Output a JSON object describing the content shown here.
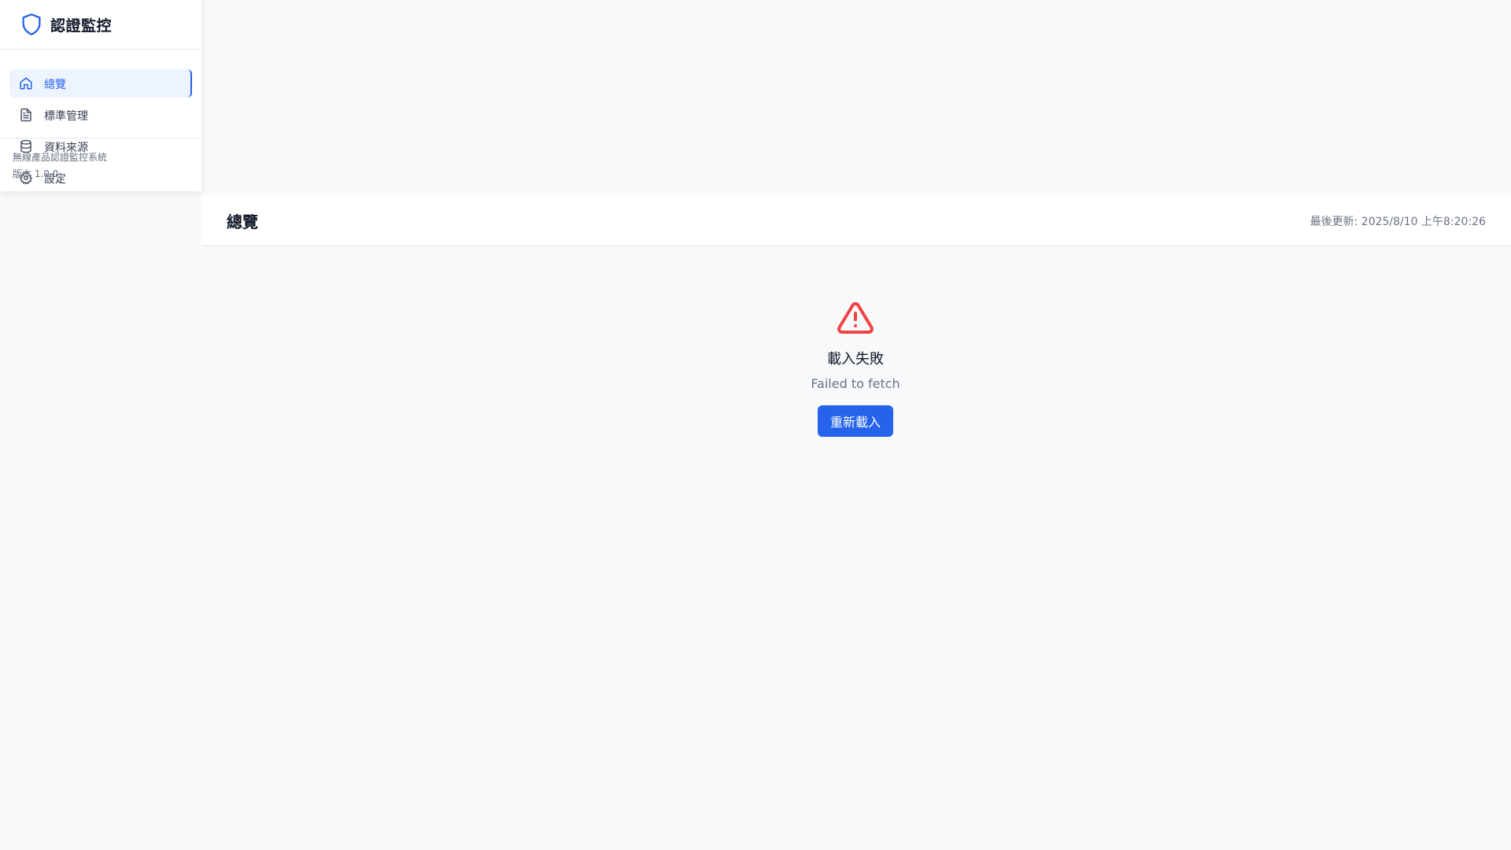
{
  "sidebar": {
    "brand_title": "認證監控",
    "brand_icon": "shield-icon",
    "items": [
      {
        "label": "總覽",
        "icon": "home-icon",
        "active": true
      },
      {
        "label": "標準管理",
        "icon": "document-icon",
        "active": false
      },
      {
        "label": "資料來源",
        "icon": "database-icon",
        "active": false
      },
      {
        "label": "設定",
        "icon": "gear-icon",
        "active": false
      }
    ],
    "footer": {
      "system_name": "無線產品認證監控系統",
      "version": "版本 1.0.0"
    }
  },
  "header": {
    "title": "總覽",
    "last_updated": "最後更新: 2025/8/10 上午8:20:26"
  },
  "error": {
    "icon": "warning-triangle-icon",
    "title": "載入失敗",
    "message": "Failed to fetch",
    "retry_label": "重新載入"
  },
  "colors": {
    "accent": "#2563eb",
    "error": "#ef4444",
    "background": "#f8f9fb"
  }
}
